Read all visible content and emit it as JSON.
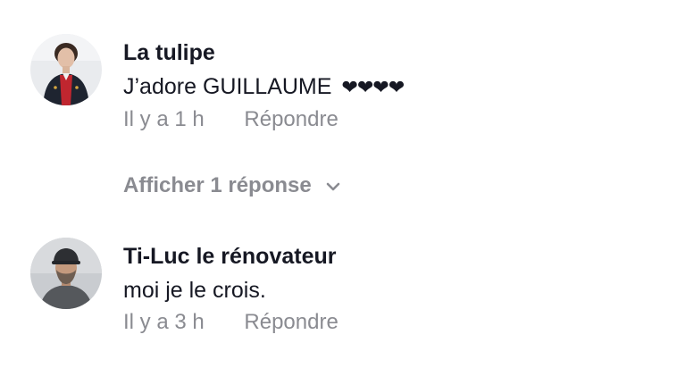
{
  "comments": [
    {
      "username": "La tulipe",
      "text": "J’adore GUILLAUME",
      "hearts": "❤❤❤❤",
      "time": "Il y a 1 h",
      "reply_label": "Répondre"
    },
    {
      "username": "Ti-Luc le rénovateur",
      "text": "moi je le crois.",
      "time": "Il y a 3 h",
      "reply_label": "Répondre"
    }
  ],
  "view_replies": {
    "label": "Afficher 1 réponse",
    "icon": "chevron-down-icon"
  },
  "colors": {
    "text_primary": "#161823",
    "text_secondary": "#8a8b91",
    "background": "#ffffff"
  }
}
